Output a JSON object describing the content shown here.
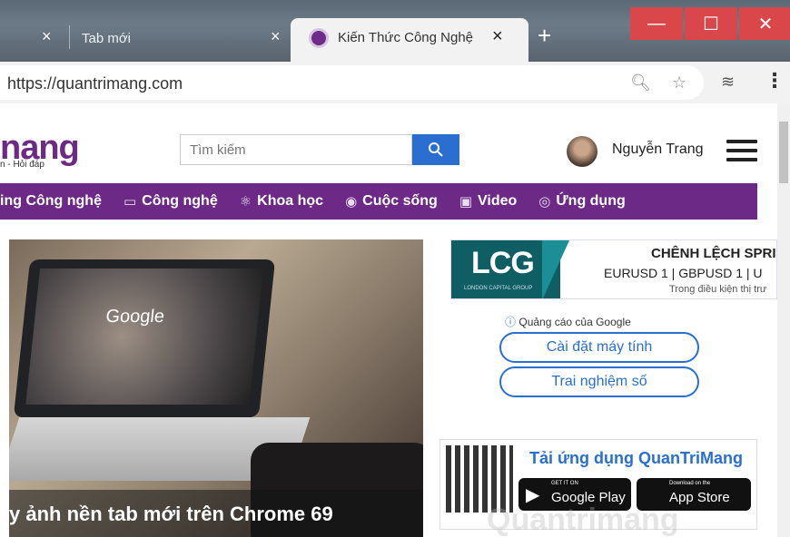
{
  "browser": {
    "tabs": [
      {
        "label": ""
      },
      {
        "label": "Tab mới"
      },
      {
        "label": "Kiến Thức Công Nghệ",
        "active": true
      }
    ],
    "close_glyph": "×",
    "new_tab_glyph": "+",
    "window": {
      "minimize": "—",
      "maximize": "☐",
      "close": "✕"
    },
    "url": "https://quantrimang.com"
  },
  "site": {
    "logo": "nang",
    "logo_sub": "n - Hỏi đáp",
    "search": {
      "placeholder": "Tìm kiếm"
    },
    "user_name": "Nguyễn Trang",
    "nav": [
      {
        "label": "ing Công nghệ",
        "icon": ""
      },
      {
        "label": "Công nghệ",
        "icon": "monitor-icon"
      },
      {
        "label": "Khoa học",
        "icon": "atom-icon"
      },
      {
        "label": "Cuộc sống",
        "icon": "person-circle-icon"
      },
      {
        "label": "Video",
        "icon": "video-icon"
      },
      {
        "label": "Ứng dụng",
        "icon": "app-icon"
      }
    ],
    "hero_caption": "y ảnh nền tab mới trên Chrome 69",
    "hero_google": "Google",
    "ad": {
      "brand": "LCG",
      "brand_sub": "LONDON CAPITAL GROUP",
      "headline": "CHÊNH LỆCH SPRI",
      "pairs": "EURUSD 1 | GBPUSD 1 | U",
      "note": "Trong điều kiện thị trư"
    },
    "google_ads_label": "Quảng cáo của Google",
    "ad_buttons": [
      "Cài đặt máy tính",
      "Trai nghiệm số"
    ],
    "app_promo": {
      "title": "Tải ứng dụng QuanTriMang",
      "google_play_small": "GET IT ON",
      "google_play": "Google Play",
      "app_store_small": "Download on the",
      "app_store": "App Store"
    },
    "watermark": "Quantrimang"
  },
  "colors": {
    "brand": "#6c2a86",
    "accent": "#2a6fcf",
    "close_red": "#d9474a"
  }
}
